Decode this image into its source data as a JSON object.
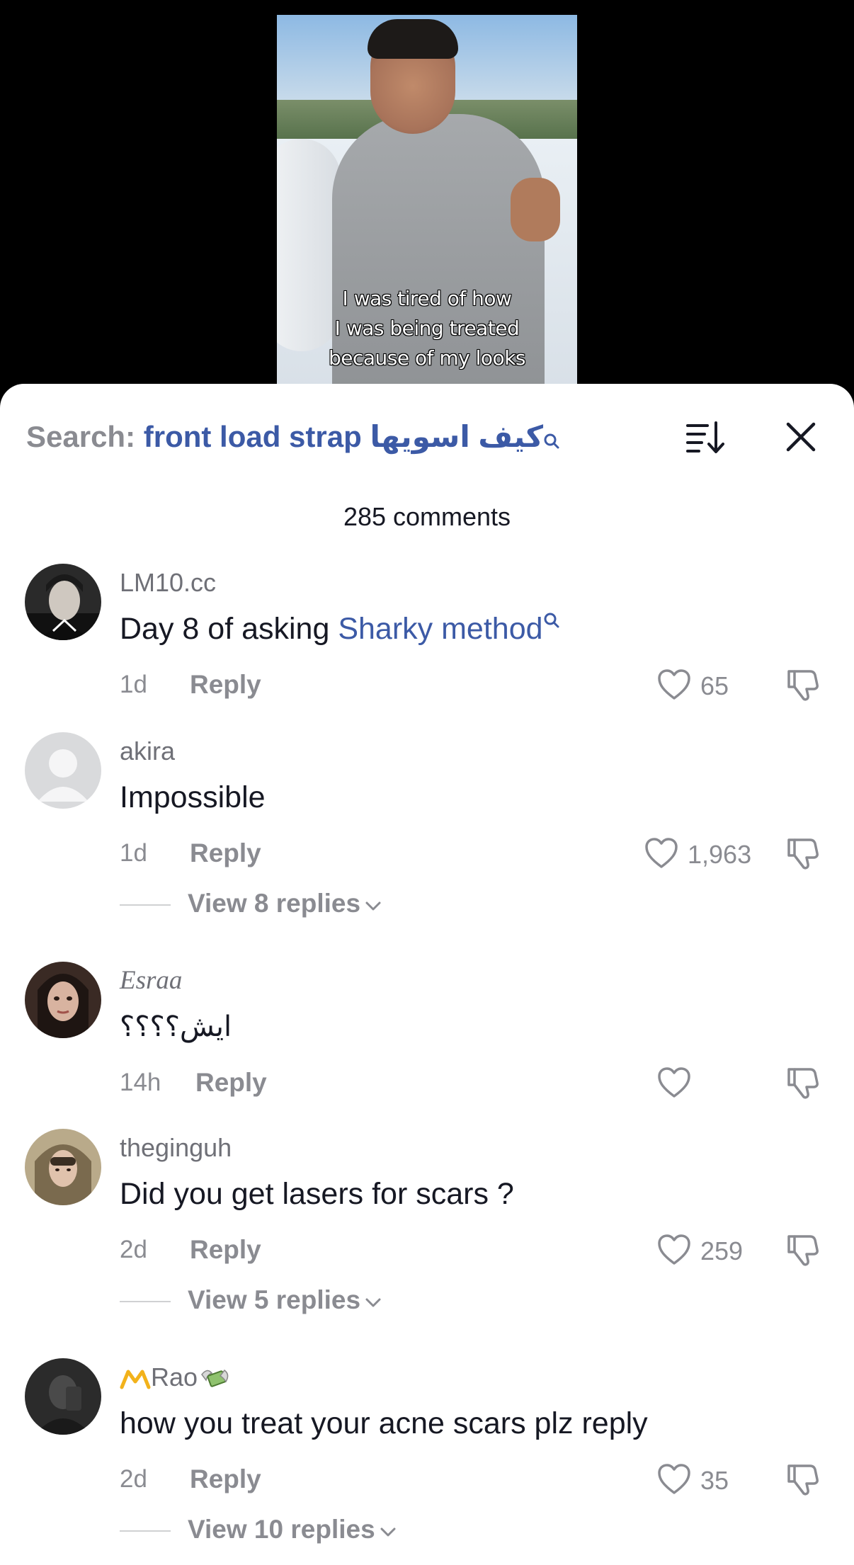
{
  "video": {
    "caption_lines": [
      "I was tired of how",
      "I was being treated",
      "because of my looks"
    ]
  },
  "search": {
    "label": "Search:",
    "query": "front load strap كيف اسويها"
  },
  "icons": {
    "sort": "sort-icon",
    "close": "close-icon",
    "heart": "heart-outline-icon",
    "dislike": "thumbs-down-icon",
    "search": "search-icon",
    "chevron": "chevron-down-icon"
  },
  "colors": {
    "link": "#3c5aa6",
    "muted": "#8a8b91",
    "text": "#161823"
  },
  "comment_count": "285 comments",
  "comments": [
    {
      "username": "LM10.cc",
      "text": "Day 8 of asking ",
      "link": "Sharky method",
      "time": "1d",
      "reply_label": "Reply",
      "likes": "65"
    },
    {
      "username": "akira",
      "text": "Impossible",
      "time": "1d",
      "reply_label": "Reply",
      "likes": "1,963",
      "view_replies": "View 8 replies"
    },
    {
      "username": "Esraa",
      "text": "ايش؟؟؟؟",
      "time": "14h",
      "reply_label": "Reply",
      "likes": ""
    },
    {
      "username": "theginguh",
      "text": "Did you get lasers for scars ?",
      "time": "2d",
      "reply_label": "Reply",
      "likes": "259",
      "view_replies": "View 5 replies"
    },
    {
      "username": "Rao",
      "text": "how you treat your acne scars plz reply",
      "time": "2d",
      "reply_label": "Reply",
      "likes": "35",
      "view_replies": "View 10 replies"
    }
  ]
}
